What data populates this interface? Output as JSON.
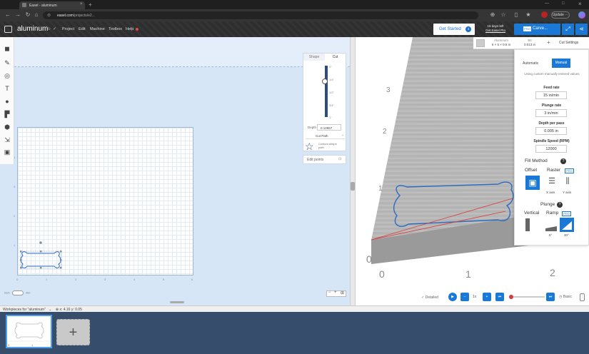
{
  "browser": {
    "tab_title": "Easel - aluminum",
    "url_host": "easel.com",
    "url_rest": "/projects/e2..."
  },
  "app": {
    "title": "aluminum",
    "menu": [
      "Project",
      "Edit",
      "Machine",
      "Toolbox",
      "Help"
    ],
    "get_started": "Get Started",
    "get_started_count": "3",
    "trial_line1": "15 days left",
    "trial_line2": "Get Easel Pro",
    "carve_label": "Carve...",
    "carve_pro": "PRO"
  },
  "cut_panel": {
    "tab_shape": "Shape",
    "tab_cut": "Cut",
    "depth_label": "Depth",
    "depth_value": "0.12967",
    "cut_path": "Cut Path",
    "custom_shape": "Custom shape path",
    "edit_points": "Edit points",
    "depth_ticks": [
      "0\"",
      "1/4\"",
      "1/2\"",
      "3/4\"",
      "1\""
    ]
  },
  "canvas": {
    "x_ticks": [
      "0",
      "1",
      "2",
      "3",
      "4",
      "5",
      "6"
    ],
    "y_ticks": [
      "4",
      "3",
      "2",
      "1"
    ],
    "toggle_left": "Inch",
    "toggle_right": "mm"
  },
  "material_bar": {
    "name": "Aluminum",
    "size": "6 × 5 × 0.5 in",
    "bit_label": "Bit",
    "bit_value": "0.013 in",
    "plus": "+",
    "cut_settings": "Cut Settings"
  },
  "settings": {
    "automatic": "Automatic",
    "manual": "Manual",
    "note": "Using custom manually entered values",
    "feed_rate_label": "Feed rate",
    "feed_rate": "15 in/min",
    "plunge_rate_label": "Plunge rate",
    "plunge_rate": "3 in/min",
    "depth_per_pass_label": "Depth per pass",
    "depth_per_pass": "0.005 in",
    "spindle_label": "Spindle Speed (RPM)",
    "spindle": "12000",
    "fill_method": "Fill Method",
    "offset": "Offset",
    "raster": "Raster",
    "pro": "PRO",
    "x_axis": "X axis",
    "y_axis": "Y axis",
    "plunge": "Plunge",
    "vertical": "Vertical",
    "ramp": "Ramp",
    "ramp_5": "5°",
    "ramp_30": "30°"
  },
  "preview": {
    "axis_x": [
      "0",
      "1",
      "2"
    ],
    "axis_y": [
      "3",
      "2",
      "1",
      "0"
    ],
    "detailed": "Detailed",
    "speed": "1x",
    "basic": "Basic"
  },
  "workpieces": {
    "header": "Workpieces for \"aluminum\"",
    "coords": "x: 4.16 y: 0.05",
    "thumb_ticks": [
      "0",
      "1"
    ]
  },
  "colors": {
    "accent": "#1a79d6",
    "canvas": "#d6e6f7",
    "workpiece_bar": "#374d6c",
    "cut_path": "#2a6cc0",
    "toolpath": "#d83a3a"
  }
}
